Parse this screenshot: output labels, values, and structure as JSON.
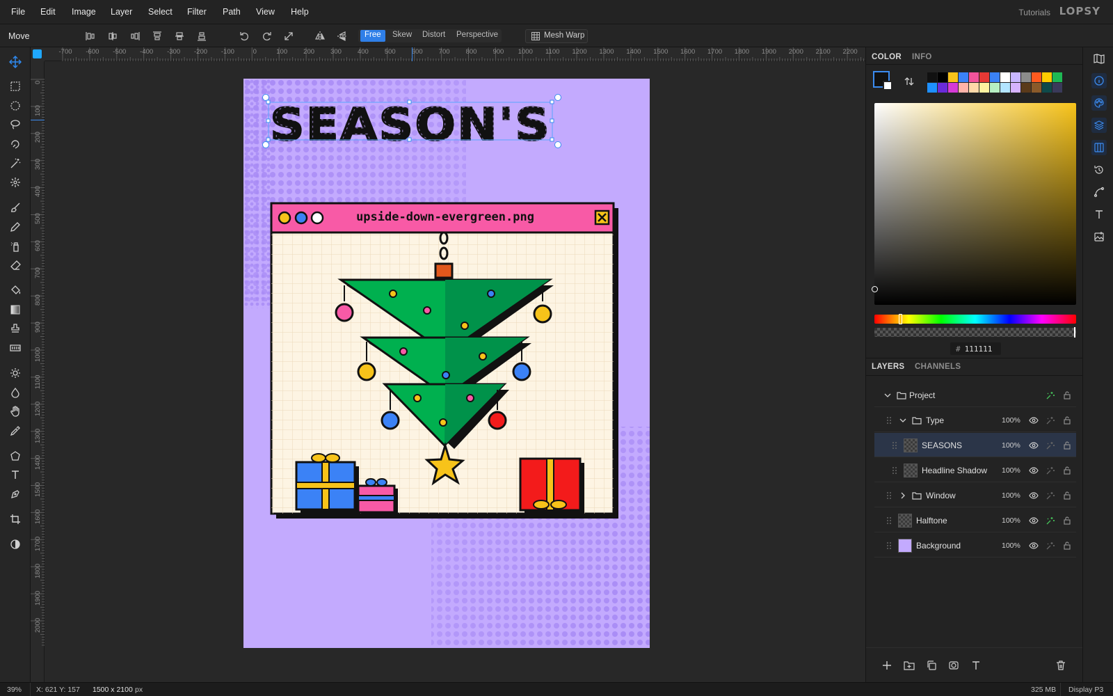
{
  "menu": [
    "File",
    "Edit",
    "Image",
    "Layer",
    "Select",
    "Filter",
    "Path",
    "View",
    "Help"
  ],
  "header": {
    "tutorials": "Tutorials",
    "logo": "LOPSY"
  },
  "options": {
    "tool_name": "Move",
    "modes": [
      "Free",
      "Skew",
      "Distort",
      "Perspective"
    ],
    "active_mode": "Free",
    "mesh_warp": "Mesh Warp"
  },
  "ruler_h": [
    "-700",
    "-600",
    "-500",
    "-400",
    "-300",
    "-200",
    "-100",
    "0",
    "100",
    "200",
    "300",
    "400",
    "500",
    "600",
    "700",
    "800",
    "900",
    "1000",
    "1100",
    "1200",
    "1300",
    "1400",
    "1500",
    "1600",
    "1700",
    "1800",
    "1900",
    "2000",
    "2100",
    "2200"
  ],
  "ruler_v": [
    "0",
    "100",
    "200",
    "300",
    "400",
    "500",
    "600",
    "700",
    "800",
    "900",
    "1000",
    "1100",
    "1200",
    "1300",
    "1400",
    "1500",
    "1600",
    "1700",
    "1800",
    "1900",
    "2000"
  ],
  "artwork": {
    "headline": "SEASON'S",
    "window_title": "upside-down-evergreen.png"
  },
  "panel": {
    "color_tab": "COLOR",
    "info_tab": "INFO",
    "hex_prefix": "#",
    "hex": "111111",
    "layers_tab": "LAYERS",
    "channels_tab": "CHANNELS",
    "swatches": [
      "#111111",
      "#000000",
      "#f7c31a",
      "#3b82f6",
      "#f2549b",
      "#e53935",
      "#3b82f6",
      "#ffffff",
      "#c8b6ff",
      "#8c8c8c",
      "#ff5a1f",
      "#ffcc00",
      "#1eb854",
      "#1e90ff",
      "#6a2bd9",
      "#d63ad6",
      "#ffb3a8",
      "#ffd9a8",
      "#fff3a0",
      "#b7f0c2",
      "#b3e5ff",
      "#d6b3ff",
      "#5a3a1a",
      "#8a5a2a",
      "#0e4a4a",
      "#3a3a5a"
    ],
    "layers": [
      {
        "name": "Project",
        "opacity": ""
      },
      {
        "name": "Type",
        "opacity": "100%"
      },
      {
        "name": "SEASONS",
        "opacity": "100%"
      },
      {
        "name": "Headline Shadow",
        "opacity": "100%"
      },
      {
        "name": "Window",
        "opacity": "100%"
      },
      {
        "name": "Halftone",
        "opacity": "100%"
      },
      {
        "name": "Background",
        "opacity": "100%"
      }
    ]
  },
  "status": {
    "zoom": "39%",
    "coords": "X: 621  Y: 157",
    "size": "1500 x 2100",
    "size_unit": "px",
    "memory": "325 MB",
    "profile": "Display P3"
  }
}
